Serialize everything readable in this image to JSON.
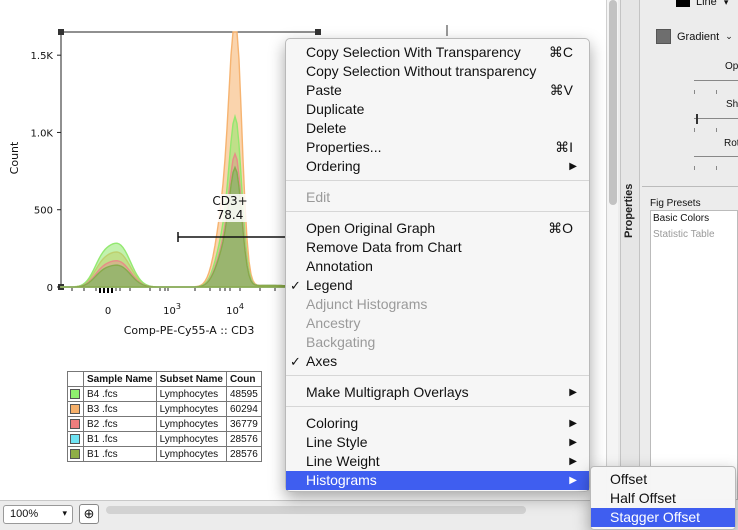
{
  "graph": {
    "y_axis_label": "Count",
    "x_axis_label": "Comp-PE-Cy55-A :: CD3",
    "y_ticks": [
      "1.5K",
      "1.0K",
      "500",
      "0"
    ],
    "x_ticks": [
      "0",
      "10",
      "10"
    ],
    "x_tick_exponents": [
      "",
      "3",
      "4"
    ],
    "gate": {
      "name": "CD3+",
      "value": "78.4"
    }
  },
  "chart_data": {
    "type": "area",
    "title": "",
    "xlabel": "Comp-PE-Cy55-A :: CD3",
    "ylabel": "Count",
    "ylim": [
      0,
      1650
    ],
    "x_scale": "biexponential",
    "series": [
      {
        "name": "B4 .fcs",
        "color": "#8fe86b",
        "peaks": [
          {
            "x": "~0",
            "y": 300
          },
          {
            "x": "~10^4",
            "y": 1000
          }
        ]
      },
      {
        "name": "B3 .fcs",
        "color": "#f6b06a",
        "peaks": [
          {
            "x": "~0",
            "y": 240
          },
          {
            "x": "~10^4",
            "y": 1600
          }
        ]
      },
      {
        "name": "B2 .fcs",
        "color": "#e98a87",
        "peaks": [
          {
            "x": "~0",
            "y": 180
          },
          {
            "x": "~10^4",
            "y": 780
          }
        ]
      },
      {
        "name": "B1 .fcs",
        "color": "#7fe0f0",
        "peaks": [
          {
            "x": "~0",
            "y": 150
          },
          {
            "x": "~10^4",
            "y": 700
          }
        ]
      },
      {
        "name": "B1 .fcs",
        "color": "#8aa843",
        "peaks": [
          {
            "x": "~0",
            "y": 150
          },
          {
            "x": "~10^4",
            "y": 700
          }
        ]
      }
    ]
  },
  "table": {
    "headers": [
      "Sample Name",
      "Subset Name",
      "Coun"
    ],
    "rows": [
      {
        "color": "#8ff06e",
        "sample": "B4 .fcs",
        "subset": "Lymphocytes",
        "count": "48595"
      },
      {
        "color": "#f6b06a",
        "sample": "B3 .fcs",
        "subset": "Lymphocytes",
        "count": "60294"
      },
      {
        "color": "#ef7d7d",
        "sample": "B2 .fcs",
        "subset": "Lymphocytes",
        "count": "36779"
      },
      {
        "color": "#6fe3f3",
        "sample": "B1 .fcs",
        "subset": "Lymphocytes",
        "count": "28576"
      },
      {
        "color": "#8fae46",
        "sample": "B1 .fcs",
        "subset": "Lymphocytes",
        "count": "28576"
      }
    ]
  },
  "context_menu": {
    "copy_transparency": {
      "label": "Copy Selection With Transparency",
      "shortcut": "⌘C"
    },
    "copy_no_transparency": {
      "label": "Copy Selection Without transparency"
    },
    "paste": {
      "label": "Paste",
      "shortcut": "⌘V"
    },
    "duplicate": {
      "label": "Duplicate"
    },
    "delete": {
      "label": "Delete"
    },
    "properties": {
      "label": "Properties...",
      "shortcut": "⌘I"
    },
    "ordering": {
      "label": "Ordering"
    },
    "edit": {
      "label": "Edit"
    },
    "open_original": {
      "label": "Open Original Graph",
      "shortcut": "⌘O"
    },
    "remove_data": {
      "label": "Remove Data from Chart"
    },
    "annotation": {
      "label": "Annotation"
    },
    "legend": {
      "label": "Legend",
      "checked": "✓"
    },
    "adjunct": {
      "label": "Adjunct Histograms"
    },
    "ancestry": {
      "label": "Ancestry"
    },
    "backgating": {
      "label": "Backgating"
    },
    "axes": {
      "label": "Axes",
      "checked": "✓"
    },
    "multigraph": {
      "label": "Make Multigraph Overlays"
    },
    "coloring": {
      "label": "Coloring"
    },
    "line_style": {
      "label": "Line Style"
    },
    "line_weight": {
      "label": "Line Weight"
    },
    "histograms": {
      "label": "Histograms"
    }
  },
  "submenu": {
    "offset": "Offset",
    "half_offset": "Half Offset",
    "stagger_offset": "Stagger Offset"
  },
  "right_panel": {
    "properties_tab": "Properties",
    "line_label": "Line",
    "gradient_label": "Gradient",
    "opacity_label": "Op",
    "shadow_label": "Sha",
    "rotation_label": "Rot",
    "fig_presets_title": "Fig Presets",
    "presets": [
      "Basic Colors",
      "Statistic Table"
    ]
  },
  "bottom_bar": {
    "zoom": "100%",
    "add_page_icon": "add-page-icon"
  }
}
